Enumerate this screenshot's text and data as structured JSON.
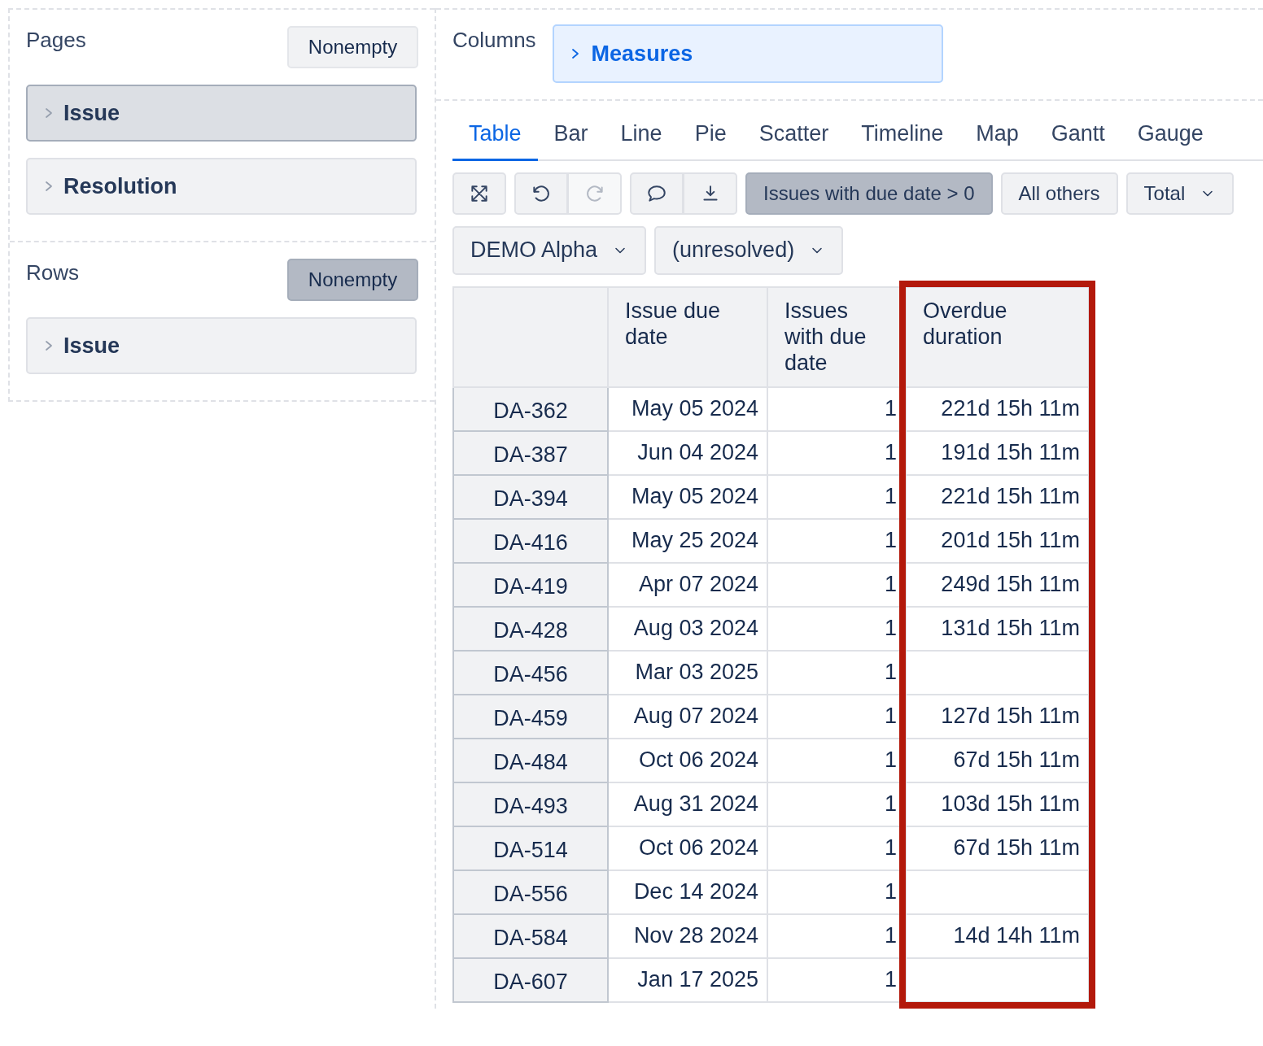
{
  "sections": [
    {
      "title": "Pages",
      "nonempty": {
        "label": "Nonempty",
        "active": false
      },
      "items": [
        {
          "label": "Issue",
          "selected": true
        },
        {
          "label": "Resolution",
          "selected": false
        }
      ]
    },
    {
      "title": "Rows",
      "nonempty": {
        "label": "Nonempty",
        "active": true
      },
      "items": [
        {
          "label": "Issue",
          "selected": false
        }
      ]
    }
  ],
  "columns": {
    "title": "Columns",
    "items": [
      {
        "label": "Measures"
      }
    ]
  },
  "tabs": [
    {
      "label": "Table",
      "selected": true
    },
    {
      "label": "Bar",
      "selected": false
    },
    {
      "label": "Line",
      "selected": false
    },
    {
      "label": "Pie",
      "selected": false
    },
    {
      "label": "Scatter",
      "selected": false
    },
    {
      "label": "Timeline",
      "selected": false
    },
    {
      "label": "Map",
      "selected": false
    },
    {
      "label": "Gantt",
      "selected": false
    },
    {
      "label": "Gauge",
      "selected": false
    }
  ],
  "toolbar": {
    "history": [
      {
        "disabled": false
      },
      {
        "disabled": true
      }
    ],
    "filters": [
      {
        "label": "Issues with due date > 0",
        "active": true,
        "dropdown": false
      },
      {
        "label": "All others",
        "active": false,
        "dropdown": false
      },
      {
        "label": "Total",
        "active": false,
        "dropdown": true
      }
    ],
    "page_filters": [
      "DEMO Alpha",
      "(unresolved)"
    ]
  },
  "table": {
    "columns": [
      {
        "label": "Issue due date",
        "highlighted": false
      },
      {
        "label": "Issues with due date",
        "highlighted": false
      },
      {
        "label": "Overdue duration",
        "highlighted": true
      }
    ],
    "rows": [
      {
        "issue": "DA-362",
        "values": [
          "May 05 2024",
          "1",
          "221d 15h 11m"
        ]
      },
      {
        "issue": "DA-387",
        "values": [
          "Jun 04 2024",
          "1",
          "191d 15h 11m"
        ]
      },
      {
        "issue": "DA-394",
        "values": [
          "May 05 2024",
          "1",
          "221d 15h 11m"
        ]
      },
      {
        "issue": "DA-416",
        "values": [
          "May 25 2024",
          "1",
          "201d 15h 11m"
        ]
      },
      {
        "issue": "DA-419",
        "values": [
          "Apr 07 2024",
          "1",
          "249d 15h 11m"
        ]
      },
      {
        "issue": "DA-428",
        "values": [
          "Aug 03 2024",
          "1",
          "131d 15h 11m"
        ]
      },
      {
        "issue": "DA-456",
        "values": [
          "Mar 03 2025",
          "1"
        ]
      },
      {
        "issue": "DA-459",
        "values": [
          "Aug 07 2024",
          "1",
          "127d 15h 11m"
        ]
      },
      {
        "issue": "DA-484",
        "values": [
          "Oct 06 2024",
          "1",
          "67d 15h 11m"
        ]
      },
      {
        "issue": "DA-493",
        "values": [
          "Aug 31 2024",
          "1",
          "103d 15h 11m"
        ]
      },
      {
        "issue": "DA-514",
        "values": [
          "Oct 06 2024",
          "1",
          "67d 15h 11m"
        ]
      },
      {
        "issue": "DA-556",
        "values": [
          "Dec 14 2024",
          "1"
        ]
      },
      {
        "issue": "DA-584",
        "values": [
          "Nov 28 2024",
          "1",
          "14d 14h 11m"
        ]
      },
      {
        "issue": "DA-607",
        "values": [
          "Jan 17 2025",
          "1"
        ]
      }
    ]
  }
}
